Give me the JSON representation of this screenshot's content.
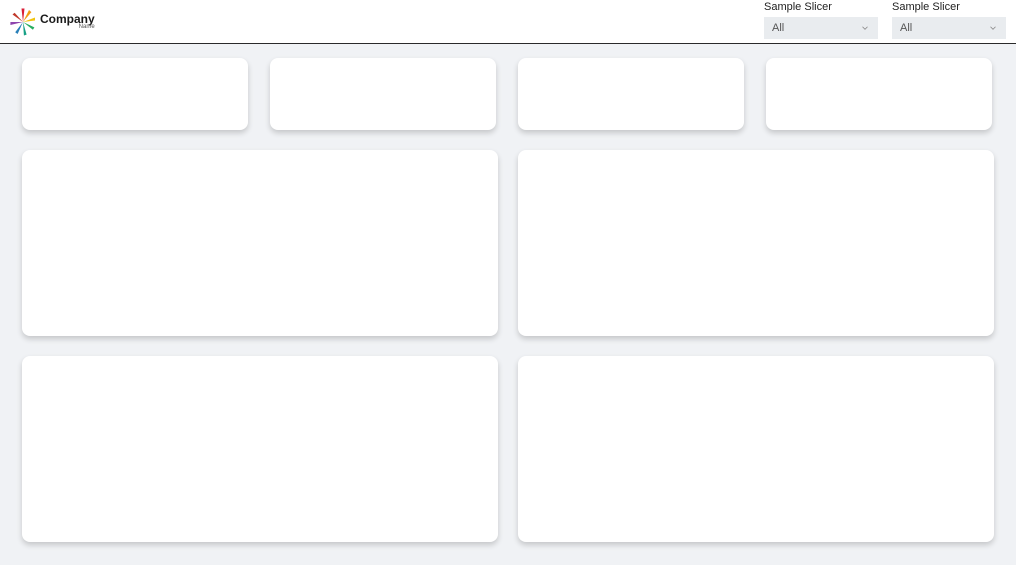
{
  "logo": {
    "main": "Company",
    "sub": "Name"
  },
  "slicers": [
    {
      "label": "Sample Slicer",
      "value": "All"
    },
    {
      "label": "Sample Slicer",
      "value": "All"
    }
  ]
}
